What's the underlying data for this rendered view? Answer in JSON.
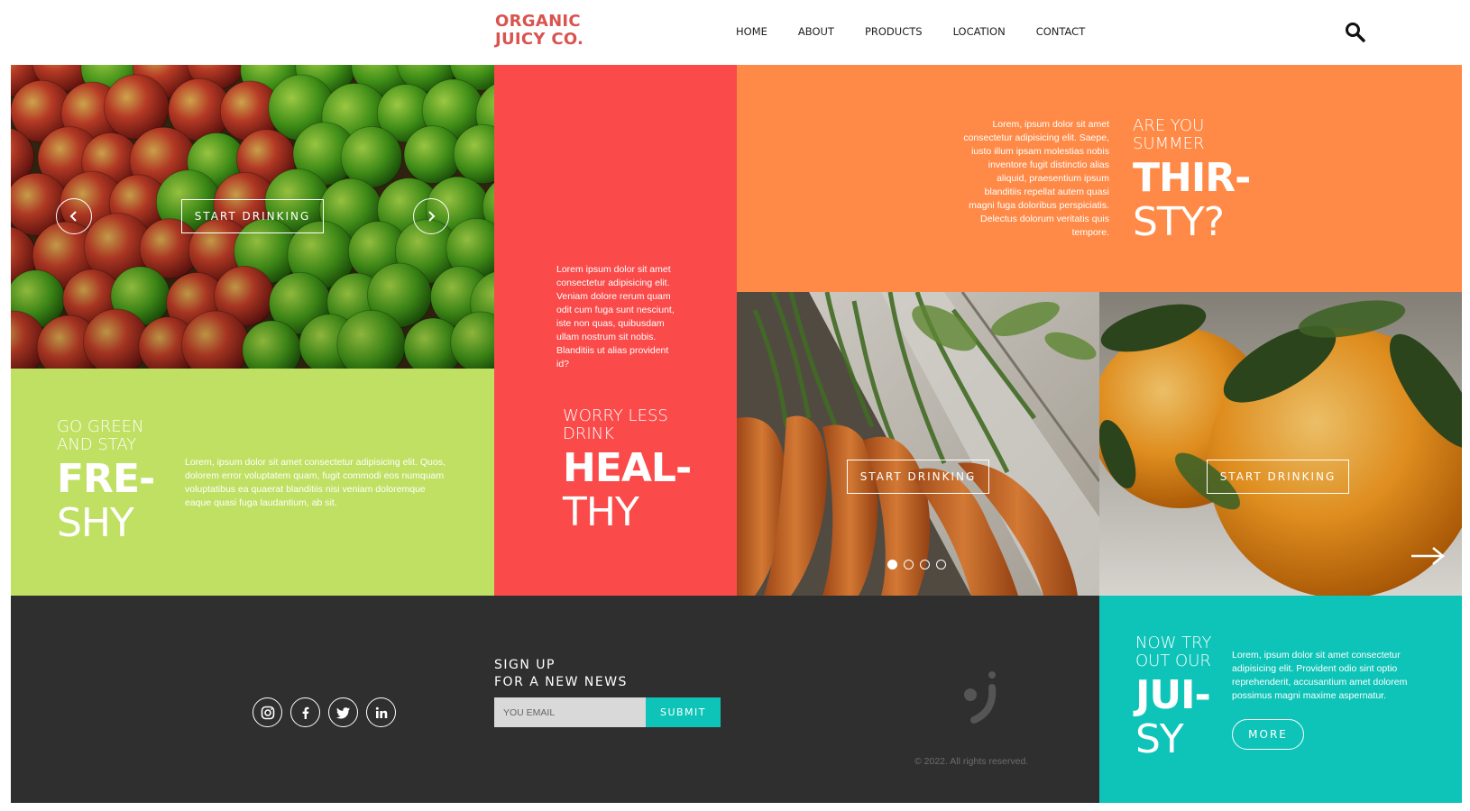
{
  "header": {
    "logo_line1": "ORGANIC",
    "logo_line2": "JUICY CO.",
    "nav": [
      "HOME",
      "ABOUT",
      "PRODUCTS",
      "LOCATION",
      "CONTACT"
    ],
    "search_icon": "search-icon"
  },
  "hero": {
    "cta": "START DRINKING",
    "prev_icon": "chevron-left-icon",
    "next_icon": "chevron-right-icon"
  },
  "green": {
    "kicker_line1": "GO GREEN",
    "kicker_line2": "AND STAY",
    "big_line1": "FRE-",
    "big_line2": "SHY",
    "body": "Lorem, ipsum dolor sit amet consectetur adipisicing elit. Quos, dolorem error voluptatem quam, fugit commodi eos numquam voluptatibus ea quaerat blanditiis nisi veniam doloremque eaque quasi fuga laudantium, ab sit."
  },
  "red": {
    "body": "Lorem ipsum dolor sit amet consectetur adipisicing elit. Veniam dolore rerum quam odit cum fuga sunt nesciunt, iste non quas, quibusdam ullam nostrum sit nobis. Blanditiis ut alias provident id?",
    "kicker_line1": "WORRY LESS",
    "kicker_line2": "DRINK",
    "big_line1": "HEAL-",
    "big_line2": "THY"
  },
  "orange": {
    "body": "Lorem, ipsum dolor sit amet consectetur adipisicing elit. Saepe, iusto illum ipsam molestias nobis inventore fugit distinctio alias aliquid, praesentium ipsum blanditiis repellat autem quasi magni fuga doloribus perspiciatis. Delectus dolorum veritatis quis tempore.",
    "kicker_line1": "ARE YOU",
    "kicker_line2": "SUMMER",
    "big_line1": "THIR-",
    "big_line2": "STY?"
  },
  "carrots": {
    "cta": "START DRINKING",
    "dots": 4,
    "active_dot": 0
  },
  "oranges": {
    "cta": "START DRINKING",
    "arrow_icon": "arrow-right-icon"
  },
  "footer": {
    "social": [
      "instagram-icon",
      "facebook-icon",
      "twitter-icon",
      "linkedin-icon"
    ],
    "signup_line1": "SIGN UP",
    "signup_line2": "FOR A NEW NEWS",
    "email_placeholder": "YOU EMAIL",
    "submit": "SUBMIT",
    "copyright": "© 2022. All rights reserved."
  },
  "teal": {
    "kicker_line1": "NOW TRY",
    "kicker_line2": "OUT OUR",
    "big_line1": "JUI-",
    "big_line2": "SY",
    "body": "Lorem, ipsum dolor sit amet consectetur adipisicing elit. Provident odio sint optio reprehenderit, accusantium amet dolorem possimus magni maxime aspernatur.",
    "cta": "MORE"
  }
}
